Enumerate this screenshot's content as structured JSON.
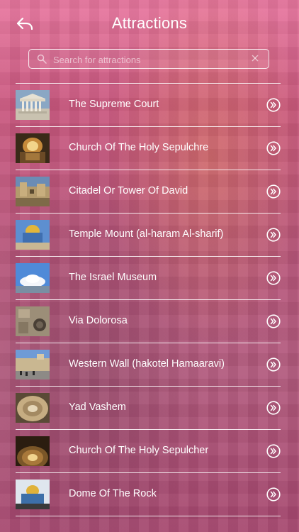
{
  "header": {
    "title": "Attractions",
    "back_icon": "back-arrow-icon"
  },
  "search": {
    "placeholder": "Search for attractions",
    "value": "",
    "search_icon": "search-icon",
    "clear_icon": "clear-icon"
  },
  "attractions": [
    {
      "label": "The Supreme Court",
      "thumb": "supreme-court-thumbnail"
    },
    {
      "label": "Church Of The Holy Sepulchre",
      "thumb": "holy-sepulchre-thumbnail"
    },
    {
      "label": "Citadel Or Tower Of David",
      "thumb": "citadel-thumbnail"
    },
    {
      "label": "Temple Mount (al-haram Al-sharif)",
      "thumb": "temple-mount-thumbnail"
    },
    {
      "label": "The Israel Museum",
      "thumb": "israel-museum-thumbnail"
    },
    {
      "label": "Via Dolorosa",
      "thumb": "via-dolorosa-thumbnail"
    },
    {
      "label": "Western Wall (hakotel Hamaaravi)",
      "thumb": "western-wall-thumbnail"
    },
    {
      "label": "Yad Vashem",
      "thumb": "yad-vashem-thumbnail"
    },
    {
      "label": "Church Of The Holy Sepulcher",
      "thumb": "holy-sepulcher-dome-thumbnail"
    },
    {
      "label": "Dome Of The Rock",
      "thumb": "dome-of-the-rock-thumbnail"
    }
  ],
  "row_action_icon": "chevron-right-circle-icon",
  "colors": {
    "background_top": "#e8779f",
    "background_bottom": "#a6476f",
    "text": "#ffffff",
    "divider": "#ffffff"
  }
}
